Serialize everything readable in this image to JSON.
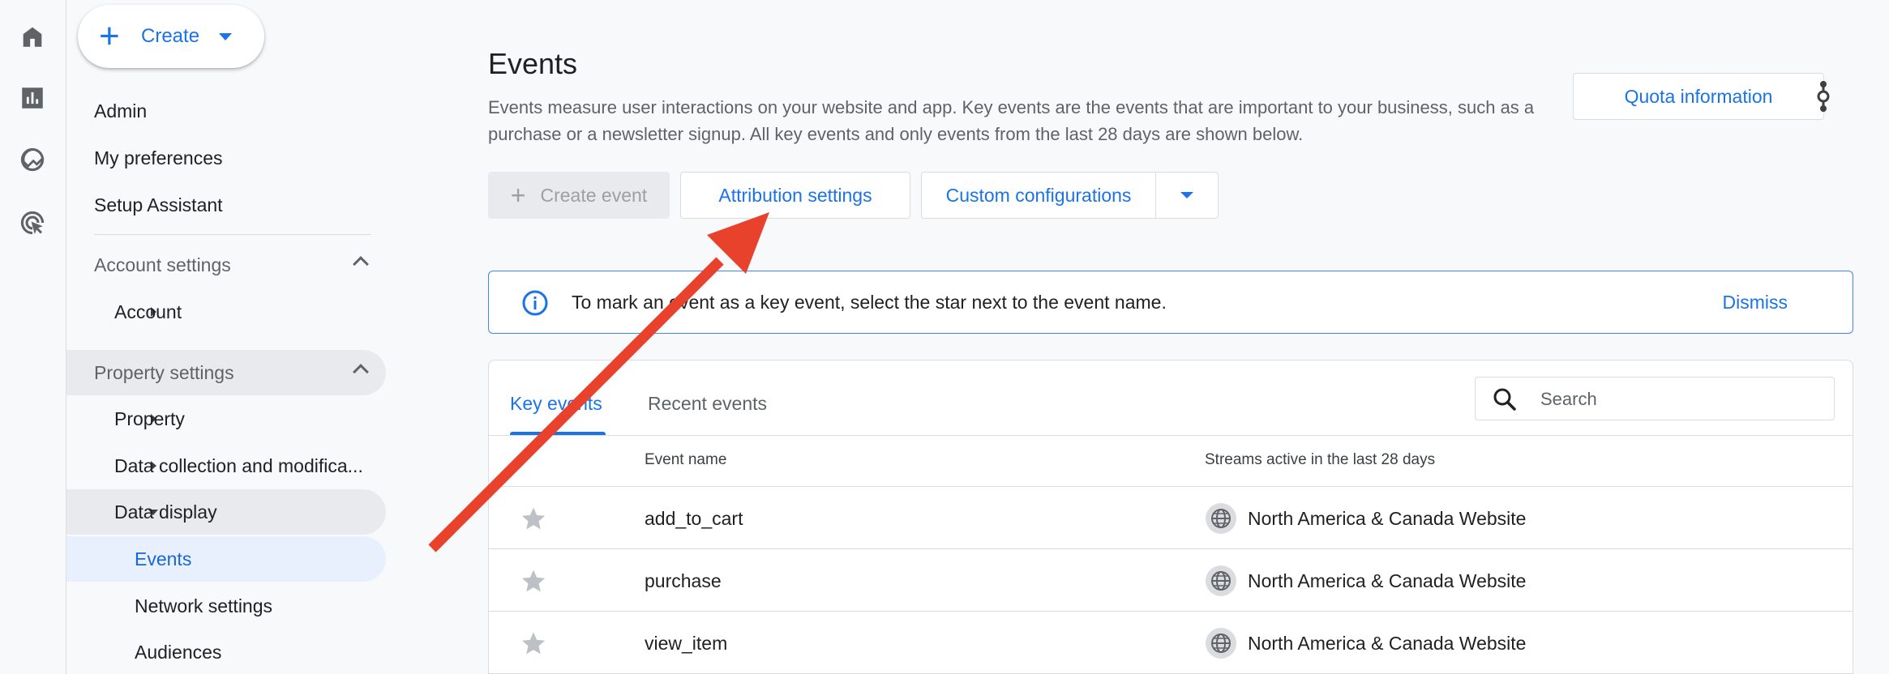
{
  "rail": {
    "icons": [
      "home-icon",
      "reports-icon",
      "explore-icon",
      "advertising-icon"
    ]
  },
  "create": {
    "label": "Create"
  },
  "nav": {
    "admin": "Admin",
    "my_preferences": "My preferences",
    "setup_assistant": "Setup Assistant",
    "account_settings": "Account settings",
    "account": "Account",
    "property_settings": "Property settings",
    "property": "Property",
    "data_collection": "Data collection and modifica...",
    "data_display": "Data display",
    "events": "Events",
    "network_settings": "Network settings",
    "audiences": "Audiences"
  },
  "page": {
    "title": "Events",
    "description": "Events measure user interactions on your website and app. Key events are the events that are important to your business, such as a purchase or a newsletter signup. All key events and only events from the last 28 days are shown below.",
    "quota_label": "Quota information"
  },
  "toolbar": {
    "create_event": "Create event",
    "attribution_settings": "Attribution settings",
    "custom_configurations": "Custom configurations"
  },
  "banner": {
    "text": "To mark an event as a key event, select the star next to the event name.",
    "dismiss": "Dismiss"
  },
  "tabs": {
    "key_events": "Key events",
    "recent_events": "Recent events"
  },
  "search": {
    "placeholder": "Search"
  },
  "table": {
    "headers": {
      "event_name": "Event name",
      "streams": "Streams active in the last 28 days"
    },
    "rows": [
      {
        "event": "add_to_cart",
        "stream": "North America & Canada Website"
      },
      {
        "event": "purchase",
        "stream": "North America & Canada Website"
      },
      {
        "event": "view_item",
        "stream": "North America & Canada Website"
      }
    ]
  },
  "colors": {
    "accent": "#1a73e8",
    "annotation_arrow": "#e8412c"
  }
}
